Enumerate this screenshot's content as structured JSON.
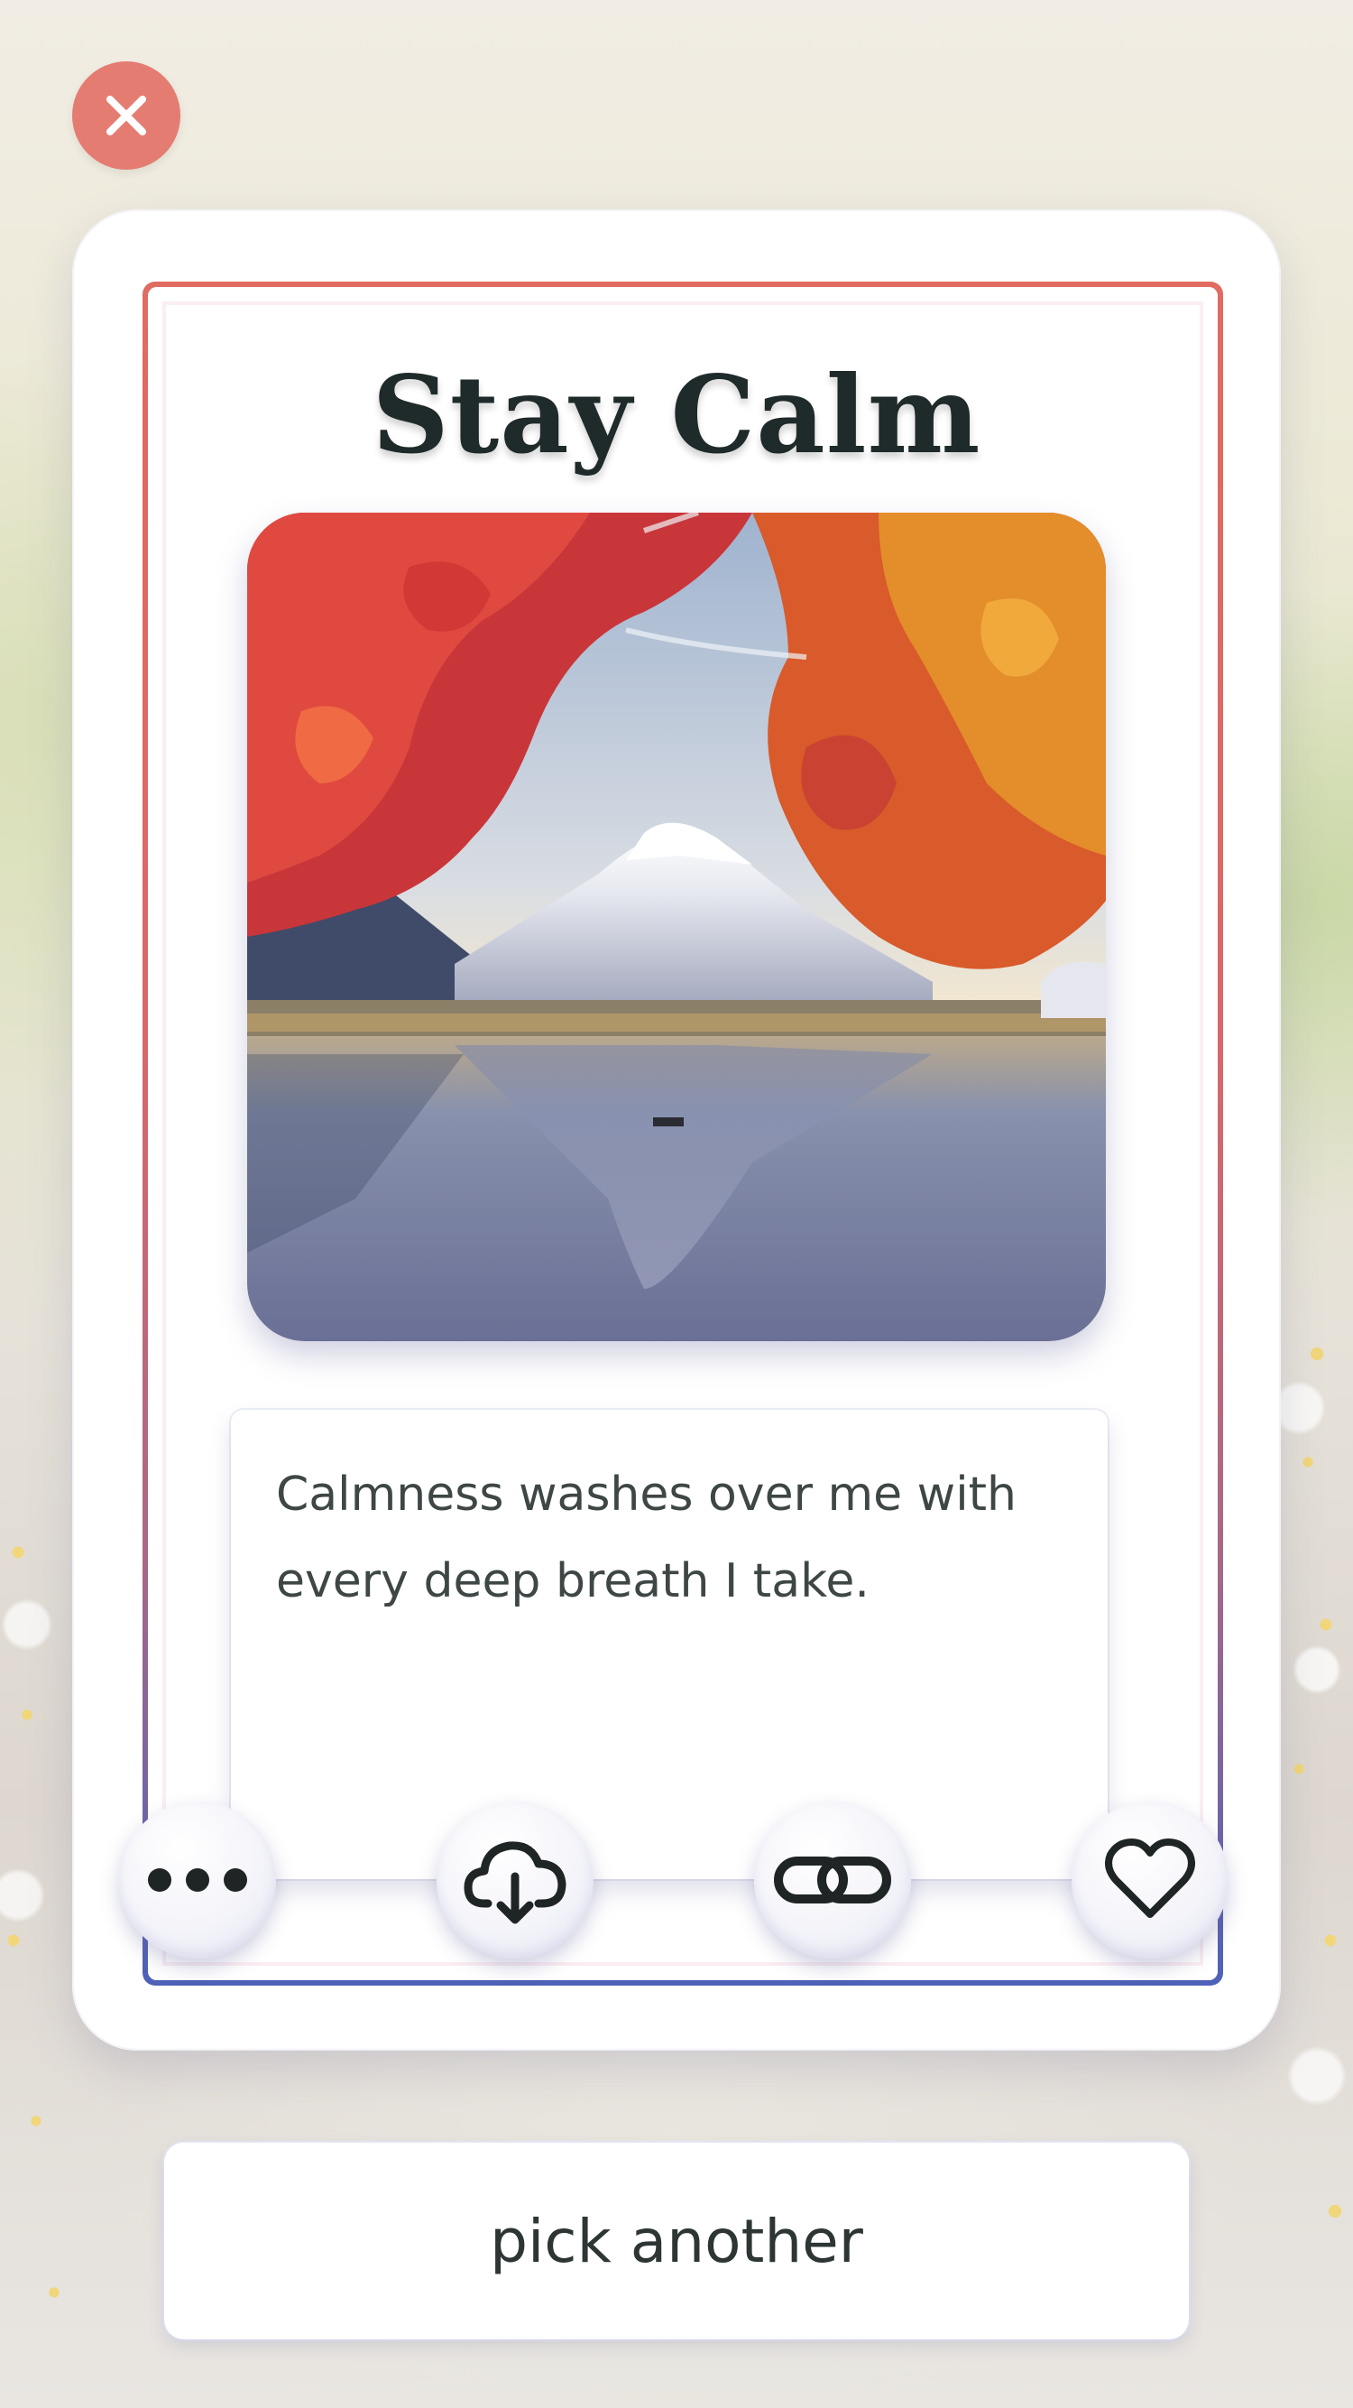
{
  "header": {
    "close_icon": "close-icon"
  },
  "card": {
    "title": "Stay Calm",
    "image_subject": "mountain-lake-autumn-maple",
    "affirmation": "Calmness washes over me with every deep breath I take.",
    "actions": [
      {
        "name": "more-button",
        "icon": "more-dots-icon"
      },
      {
        "name": "download-button",
        "icon": "cloud-download-icon"
      },
      {
        "name": "link-button",
        "icon": "link-icon"
      },
      {
        "name": "favorite-button",
        "icon": "heart-icon"
      }
    ]
  },
  "footer": {
    "pick_another_label": "pick another"
  },
  "colors": {
    "accent": "#e57c72",
    "frame_top": "#e06b60",
    "frame_bottom": "#4d62b8",
    "text": "#3e4646",
    "title": "#1f2a2a"
  }
}
